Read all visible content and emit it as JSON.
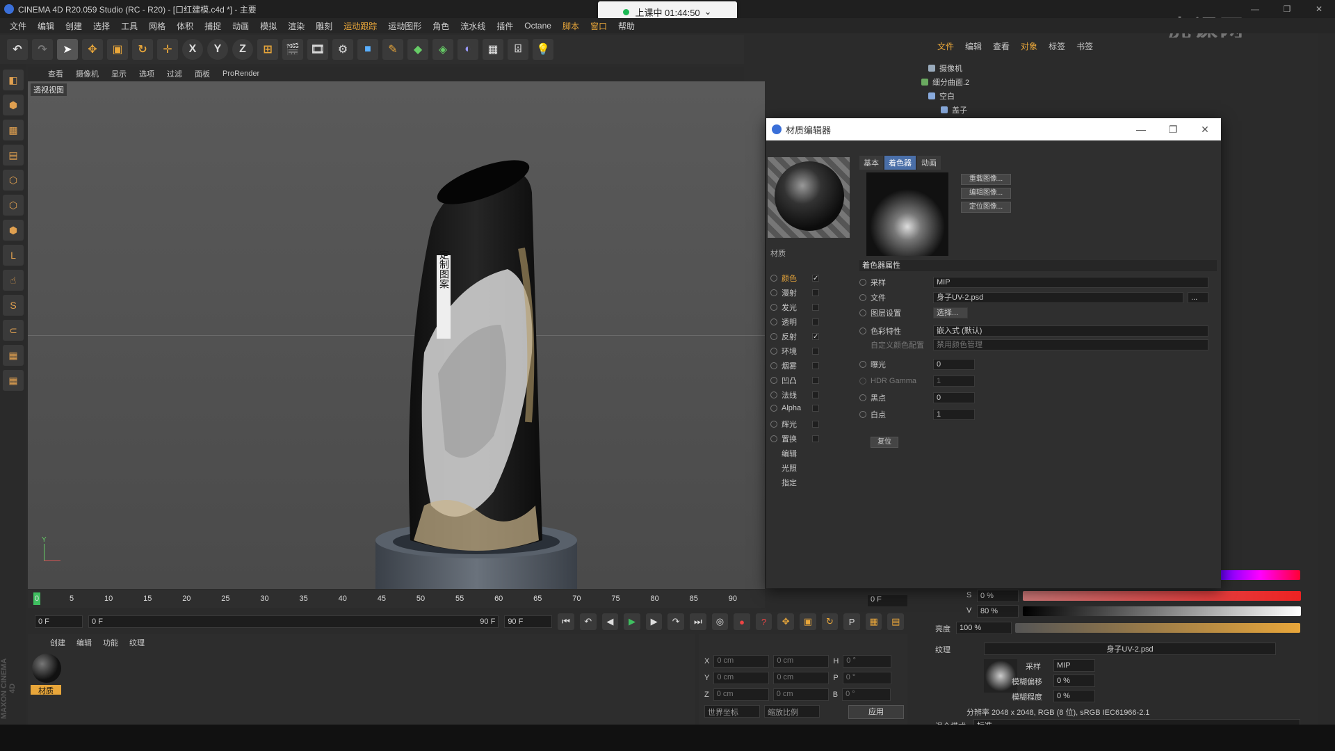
{
  "window": {
    "title": "CINEMA 4D R20.059 Studio (RC - R20) - [口红建模.c4d *] - 主要",
    "controls": [
      "—",
      "❐",
      "✕"
    ]
  },
  "timer": {
    "label": "上课中 01:44:50",
    "chevron": "⌄"
  },
  "menubar": [
    "文件",
    "编辑",
    "创建",
    "选择",
    "工具",
    "网格",
    "体积",
    "捕捉",
    "动画",
    "模拟",
    "渲染",
    "雕刻",
    "运动跟踪",
    "运动图形",
    "角色",
    "流水线",
    "插件",
    "Octane",
    "脚本",
    "窗口",
    "帮助"
  ],
  "toolbar": {
    "axis_x": "X",
    "axis_y": "Y",
    "axis_z": "Z",
    "accent": "#e8a63a"
  },
  "viewport": {
    "menu": [
      "查看",
      "摄像机",
      "显示",
      "选项",
      "过滤",
      "面板",
      "ProRender"
    ],
    "label": "透视视图",
    "bottle_text": "定制图案",
    "axis_y": "Y"
  },
  "timeline": {
    "ticks": [
      "0",
      "5",
      "10",
      "15",
      "20",
      "25",
      "30",
      "35",
      "40",
      "45",
      "50",
      "55",
      "60",
      "65",
      "70",
      "75",
      "80",
      "85",
      "90"
    ],
    "frame_end": "0 F"
  },
  "transport": {
    "start": "0 F",
    "range_start": "0 F",
    "range_end": "90 F",
    "end": "90 F"
  },
  "material_manager": {
    "tabs": [
      "创建",
      "编辑",
      "功能",
      "纹理"
    ],
    "material_name": "材质"
  },
  "coords": {
    "rows": [
      {
        "axis": "X",
        "pos": "0 cm",
        "size": "0 cm",
        "rot_label": "H",
        "rot": "0 °"
      },
      {
        "axis": "Y",
        "pos": "0 cm",
        "size": "0 cm",
        "rot_label": "P",
        "rot": "0 °"
      },
      {
        "axis": "Z",
        "pos": "0 cm",
        "size": "0 cm",
        "rot_label": "B",
        "rot": "0 °"
      }
    ],
    "mode1": "世界坐标",
    "mode2": "缩放比例",
    "apply": "应用"
  },
  "maxon": "MAXON CINEMA 4D",
  "object_manager": {
    "tabs": [
      "文件",
      "编辑",
      "查看",
      "对象",
      "标签",
      "书签"
    ],
    "objects": [
      "摄像机",
      "细分曲面.2",
      "空白",
      "盖子"
    ]
  },
  "material_editor": {
    "title": "材质编辑器",
    "tabs": [
      "基本",
      "着色器",
      "动画"
    ],
    "active_tab": "着色器",
    "material_name": "材质",
    "channels": [
      {
        "name": "颜色",
        "checked": true,
        "active": true
      },
      {
        "name": "漫射",
        "checked": false
      },
      {
        "name": "发光",
        "checked": false
      },
      {
        "name": "透明",
        "checked": false
      },
      {
        "name": "反射",
        "checked": true
      },
      {
        "name": "环境",
        "checked": false
      },
      {
        "name": "烟雾",
        "checked": false
      },
      {
        "name": "凹凸",
        "checked": false
      },
      {
        "name": "法线",
        "checked": false
      },
      {
        "name": "Alpha",
        "checked": false
      },
      {
        "name": "辉光",
        "checked": false
      },
      {
        "name": "置换",
        "checked": false
      }
    ],
    "extra": [
      "编辑",
      "光照",
      "指定"
    ],
    "buttons": [
      "重载图像...",
      "编辑图像...",
      "定位图像..."
    ],
    "section": "着色器属性",
    "props": {
      "sampling_label": "采样",
      "sampling": "MIP",
      "file_label": "文件",
      "file": "身子UV-2.psd",
      "file_btn": "...",
      "layer_label": "图层设置",
      "layer_btn": "选择...",
      "color_profile_label": "色彩特性",
      "color_profile": "嵌入式 (默认)",
      "custom_profile_label": "自定义颜色配置",
      "custom_profile": "禁用颜色管理",
      "exposure_label": "曝光",
      "exposure": "0",
      "hdr_label": "HDR Gamma",
      "hdr": "1",
      "black_label": "黑点",
      "black": "0",
      "white_label": "白点",
      "white": "1",
      "reset": "复位"
    }
  },
  "attr_panel": {
    "s_label": "S",
    "s_value": "0 %",
    "v_label": "V",
    "v_value": "80 %",
    "brightness_label": "亮度",
    "brightness": "100 %",
    "texture_label": "纹理",
    "texture": "身子UV-2.psd",
    "sampling_label": "采样",
    "sampling": "MIP",
    "blur_offset_label": "模糊偏移",
    "blur_offset": "0 %",
    "blur_scale_label": "模糊程度",
    "blur_scale": "0 %",
    "resolution": "分辨率 2048 x 2048, RGB (8 位), sRGB IEC61966-2.1",
    "blend_label": "混合模式",
    "blend": "标准"
  },
  "watermark": "虎课网"
}
